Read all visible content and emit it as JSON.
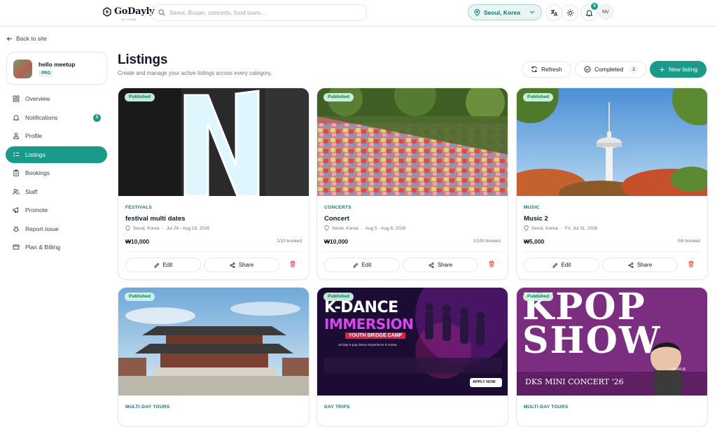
{
  "header": {
    "logo_text": "GoDayly",
    "logo_sub": "PLANNER",
    "search_placeholder": "Seoul, Busan, concerts, food tours...",
    "location": "Seoul, Korea",
    "notifications_count": "5",
    "user_initials": "NV"
  },
  "sidebar": {
    "back_label": "Back to site",
    "org_name": "hello meetup",
    "org_plan": "PRO",
    "items": [
      {
        "label": "Overview",
        "icon": "grid-icon"
      },
      {
        "label": "Notifications",
        "icon": "bell-icon",
        "badge": "5"
      },
      {
        "label": "Profile",
        "icon": "user-icon"
      },
      {
        "label": "Listings",
        "icon": "list-icon",
        "active": true
      },
      {
        "label": "Bookings",
        "icon": "clipboard-icon"
      },
      {
        "label": "Staff",
        "icon": "users-icon"
      },
      {
        "label": "Promote",
        "icon": "megaphone-icon"
      },
      {
        "label": "Report issue",
        "icon": "bug-icon"
      },
      {
        "label": "Plan & Billing",
        "icon": "credit-card-icon"
      }
    ]
  },
  "main": {
    "title": "Listings",
    "subtitle": "Create and manage your active listings across every category.",
    "refresh_label": "Refresh",
    "completed_label": "Completed",
    "completed_count": "2",
    "new_label": "New listing",
    "edit_label": "Edit",
    "share_label": "Share",
    "status_label": "Published"
  },
  "listings": [
    {
      "category": "FESTIVALS",
      "title": "festival multi dates",
      "location": "Seoul, Korea",
      "dates": "Jul 29 - Aug 19, 2026",
      "price": "₩10,000",
      "booked": "1/10 booked",
      "image": "letter-n-neon-sign"
    },
    {
      "category": "CONCERTS",
      "title": "Concert",
      "location": "Seoul, Korea",
      "dates": "Aug 5 - Aug 6, 2026",
      "price": "₩10,000",
      "booked": "1/100 booked",
      "image": "love-locks-fence"
    },
    {
      "category": "MUSIC",
      "title": "Music 2",
      "location": "Seoul, Korea",
      "dates": "Fri, Jul 31, 2026",
      "price": "₩5,000",
      "booked": "0/6 booked",
      "image": "namsan-tower"
    },
    {
      "category": "MULTI-DAY TOURS",
      "image": "gyeongbokgung-palace"
    },
    {
      "category": "DAY TRIPS",
      "image": "k-dance-poster",
      "poster": {
        "line1": "K-DANCE",
        "line2": "IMMERSION",
        "line3": "YOUTH BRIDGE CAMP",
        "line4": "10 Day K-pop Dance Experience in Korea",
        "cta": "APPLY NOW"
      }
    },
    {
      "category": "MULTI-DAY TOURS",
      "image": "kpop-show-poster",
      "poster": {
        "line1": "KPOP",
        "line2": "SHOW",
        "line3": "DKS MINI CONCERT '26",
        "line4": "CHARLIE"
      }
    }
  ],
  "colors": {
    "accent": "#1a9b8a",
    "accent_soft": "#e8f5f2",
    "danger": "#ef4444"
  }
}
